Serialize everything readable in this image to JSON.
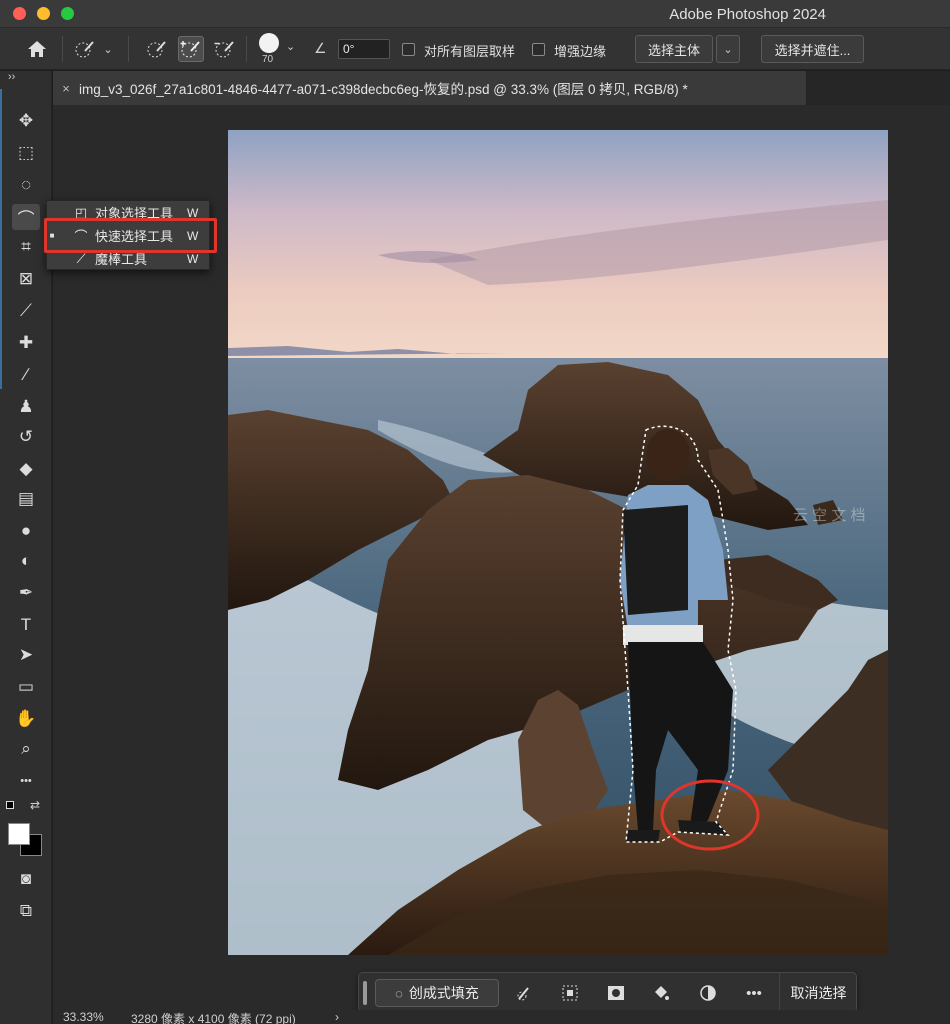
{
  "app": {
    "title": "Adobe Photoshop 2024"
  },
  "options_bar": {
    "brush_size": "70",
    "angle_value": "0°",
    "sample_all_layers_label": "对所有图层取样",
    "auto_enhance_label": "增强边缘",
    "select_subject_label": "选择主体",
    "select_and_mask_label": "选择并遮住..."
  },
  "document_tab": {
    "title": "img_v3_026f_27a1c801-4846-4477-a071-c398decbc6eg-恢复的.psd @ 33.3% (图层 0 拷贝, RGB/8) *",
    "close": "×"
  },
  "toolbar": {
    "collapse": "››",
    "tools": [
      {
        "name": "move-tool-icon",
        "glyph": "✥"
      },
      {
        "name": "marquee-tool-icon",
        "glyph": "⬚"
      },
      {
        "name": "lasso-tool-icon",
        "glyph": "◌"
      },
      {
        "name": "quick-selection-tool-icon",
        "glyph": "⌒"
      },
      {
        "name": "crop-tool-icon",
        "glyph": "⌗"
      },
      {
        "name": "frame-tool-icon",
        "glyph": "⊠"
      },
      {
        "name": "eyedropper-tool-icon",
        "glyph": "⟋"
      },
      {
        "name": "healing-brush-tool-icon",
        "glyph": "✚"
      },
      {
        "name": "brush-tool-icon",
        "glyph": "∕"
      },
      {
        "name": "clone-stamp-tool-icon",
        "glyph": "♟"
      },
      {
        "name": "history-brush-tool-icon",
        "glyph": "↺"
      },
      {
        "name": "eraser-tool-icon",
        "glyph": "◆"
      },
      {
        "name": "gradient-tool-icon",
        "glyph": "▤"
      },
      {
        "name": "blur-tool-icon",
        "glyph": "●"
      },
      {
        "name": "dodge-tool-icon",
        "glyph": "◐"
      },
      {
        "name": "pen-tool-icon",
        "glyph": "✒"
      },
      {
        "name": "type-tool-icon",
        "glyph": "T"
      },
      {
        "name": "path-selection-tool-icon",
        "glyph": "➤"
      },
      {
        "name": "rectangle-tool-icon",
        "glyph": "▭"
      },
      {
        "name": "hand-tool-icon",
        "glyph": "✋"
      },
      {
        "name": "zoom-tool-icon",
        "glyph": "⌕"
      },
      {
        "name": "more-tools-icon",
        "glyph": "•••"
      }
    ],
    "swap": "⇄",
    "quick_mask": "◙",
    "screen_mode": "⧉"
  },
  "flyout": {
    "items": [
      {
        "label": "对象选择工具",
        "key": "W",
        "icon": "◰",
        "selected": false
      },
      {
        "label": "快速选择工具",
        "key": "W",
        "icon": "⌒",
        "selected": true
      },
      {
        "label": "魔棒工具",
        "key": "W",
        "icon": "⟋",
        "selected": false
      }
    ]
  },
  "watermark": "云 空 文 档",
  "context_bar": {
    "generative_fill_label": "创成式填充",
    "deselect_label": "取消选择",
    "more": "•••"
  },
  "status_bar": {
    "zoom": "33.33%",
    "doc_size": "3280 像素 x 4100 像素 (72 ppi)",
    "arrow": "›"
  },
  "colors": {
    "highlight_annotation": "#e0352b",
    "foreground_color": "#ffffff",
    "background_color": "#000000"
  }
}
